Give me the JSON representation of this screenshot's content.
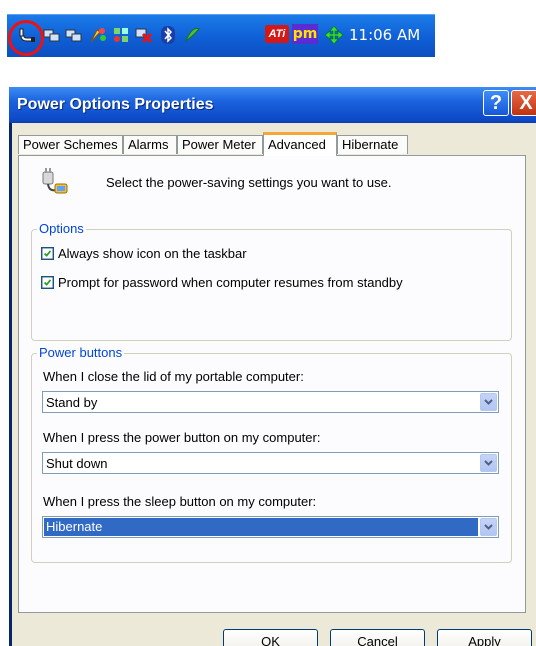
{
  "tray": {
    "clock": "11:06 AM",
    "icons": [
      "power-plug-icon",
      "network-icon",
      "network-icon",
      "paint-icon",
      "network-signal-icon",
      "network-disabled-icon",
      "bluetooth-icon",
      "security-icon",
      "ati-icon",
      "pm-icon",
      "move-icon"
    ],
    "ati_label": "ATi",
    "pm_label": "pm",
    "highlight_color": "#ee1111"
  },
  "window": {
    "title": "Power Options Properties",
    "help_button": "?",
    "close_button": "X",
    "tabs": [
      {
        "label": "Power Schemes",
        "active": false
      },
      {
        "label": "Alarms",
        "active": false
      },
      {
        "label": "Power Meter",
        "active": false
      },
      {
        "label": "Advanced",
        "active": true
      },
      {
        "label": "Hibernate",
        "active": false
      }
    ],
    "header_text": "Select the power-saving settings you want to use.",
    "options": {
      "legend": "Options",
      "checkboxes": [
        {
          "label": "Always show icon on the taskbar",
          "checked": true
        },
        {
          "label": "Prompt for password when computer resumes from standby",
          "checked": true
        }
      ]
    },
    "power_buttons": {
      "legend": "Power buttons",
      "fields": [
        {
          "label": "When I close the lid of my portable computer:",
          "value": "Stand by"
        },
        {
          "label": "When I press the power button on my computer:",
          "value": "Shut down"
        },
        {
          "label": "When I press the sleep button on my computer:",
          "value": "Hibernate"
        }
      ]
    },
    "buttons": {
      "ok": "OK",
      "cancel": "Cancel",
      "apply": "Apply"
    },
    "accent_color": "#0046d5",
    "tab_highlight_color": "#f5a636"
  }
}
